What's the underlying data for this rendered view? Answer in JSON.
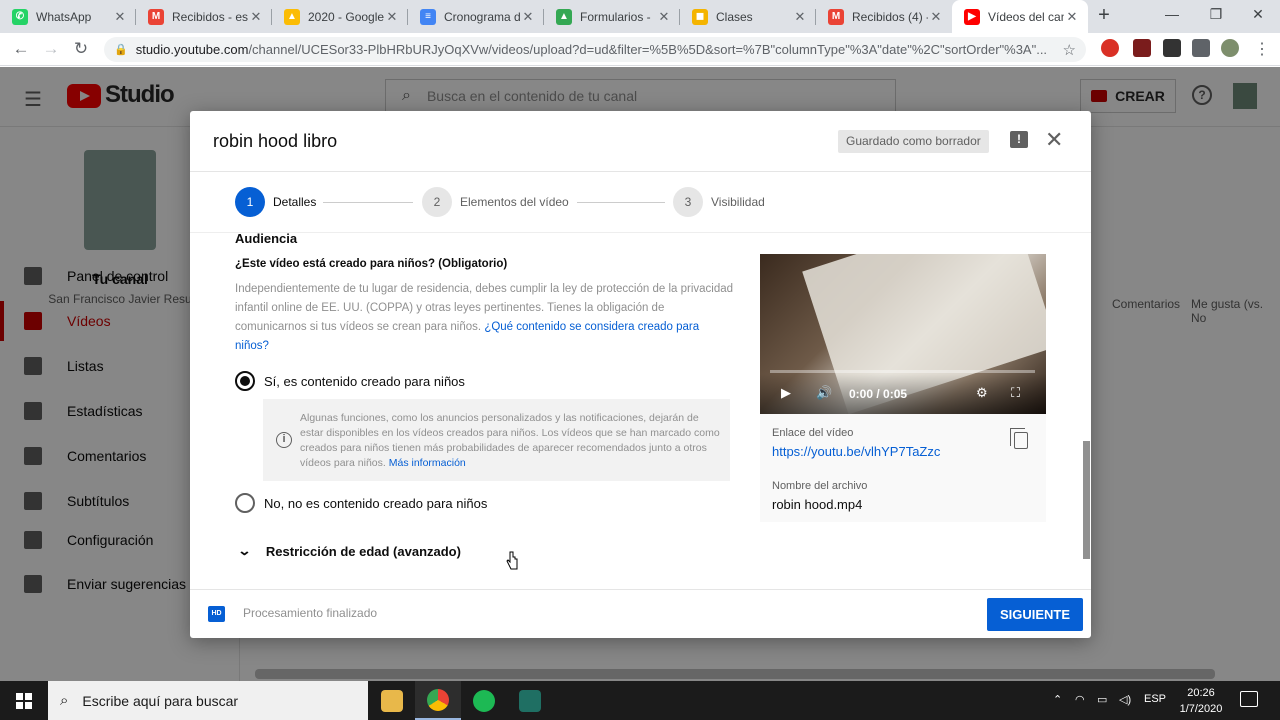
{
  "browser": {
    "tabs": [
      {
        "title": "WhatsApp",
        "icon": "whatsapp-icon",
        "color": "#25d366",
        "glyph": "✆"
      },
      {
        "title": "Recibidos - esa",
        "icon": "gmail-icon",
        "color": "#ea4335",
        "glyph": "M"
      },
      {
        "title": "2020 - Google",
        "icon": "google-drive-icon",
        "color": "#fbbc04",
        "glyph": "▲"
      },
      {
        "title": "Cronograma d",
        "icon": "google-docs-icon",
        "color": "#4285f4",
        "glyph": "≡"
      },
      {
        "title": "Formularios -",
        "icon": "google-drive-icon",
        "color": "#34a853",
        "glyph": "▲"
      },
      {
        "title": "Clases",
        "icon": "google-classroom-icon",
        "color": "#f4b400",
        "glyph": "◼"
      },
      {
        "title": "Recibidos (4) -",
        "icon": "gmail-icon",
        "color": "#ea4335",
        "glyph": "M"
      },
      {
        "title": "Vídeos del can",
        "icon": "youtube-icon",
        "color": "#ff0000",
        "glyph": "▶"
      }
    ],
    "url_host": "studio.youtube.com",
    "url_path": "/channel/UCESor33-PlbHRbURJyOqXVw/videos/upload?d=ud&filter=%5B%5D&sort=%7B\"columnType\"%3A\"date\"%2C\"sortOrder\"%3A\"..."
  },
  "studio": {
    "logo_text": "Studio",
    "search_placeholder": "Busca en el contenido de tu canal",
    "create_label": "CREAR",
    "channel_title": "Tu canal",
    "channel_name": "San Francisco Javier Resu",
    "nav": [
      {
        "label": "Panel de control",
        "icon": "dashboard-icon"
      },
      {
        "label": "Vídeos",
        "icon": "videos-icon",
        "selected": true
      },
      {
        "label": "Listas",
        "icon": "playlists-icon"
      },
      {
        "label": "Estadísticas",
        "icon": "analytics-icon"
      },
      {
        "label": "Comentarios",
        "icon": "comments-icon"
      },
      {
        "label": "Subtítulos",
        "icon": "subtitles-icon"
      },
      {
        "label": "Configuración",
        "icon": "settings-icon"
      },
      {
        "label": "Enviar sugerencias",
        "icon": "feedback-icon"
      }
    ],
    "columns": [
      "Comentarios",
      "Me gusta (vs. No"
    ]
  },
  "dialog": {
    "title": "robin hood libro",
    "draft_chip": "Guardado como borrador",
    "steps": [
      {
        "num": "1",
        "label": "Detalles"
      },
      {
        "num": "2",
        "label": "Elementos del vídeo"
      },
      {
        "num": "3",
        "label": "Visibilidad"
      }
    ],
    "section_title": "Audiencia",
    "question": "¿Este vídeo está creado para niños? (Obligatorio)",
    "description": "Independientemente de tu lugar de residencia, debes cumplir la ley de protección de la privacidad infantil online de EE. UU. (COPPA) y otras leyes pertinentes. Tienes la obligación de comunicarnos si tus vídeos se crean para niños.",
    "description_link": "¿Qué contenido se considera creado para niños?",
    "option_yes": "Sí, es contenido creado para niños",
    "info_text": "Algunas funciones, como los anuncios personalizados y las notificaciones, dejarán de estar disponibles en los vídeos creados para niños. Los vídeos que se han marcado como creados para niños tienen más probabilidades de aparecer recomendados junto a otros vídeos para niños.",
    "info_link": "Más información",
    "option_no": "No, no es contenido creado para niños",
    "age_restriction": "Restricción de edad (avanzado)",
    "video_time": "0:00 / 0:05",
    "link_label": "Enlace del vídeo",
    "link_url": "https://youtu.be/vlhYP7TaZzc",
    "file_label": "Nombre del archivo",
    "file_name": "robin hood.mp4",
    "hd_badge": "HD",
    "status": "Procesamiento finalizado",
    "next_label": "SIGUIENTE"
  },
  "taskbar": {
    "search_placeholder": "Escribe aquí para buscar",
    "lang": "ESP",
    "time": "20:26",
    "date": "1/7/2020"
  },
  "colors": {
    "accent": "#065fd4",
    "youtube_red": "#ff0000",
    "selected_nav": "#cc0000"
  }
}
